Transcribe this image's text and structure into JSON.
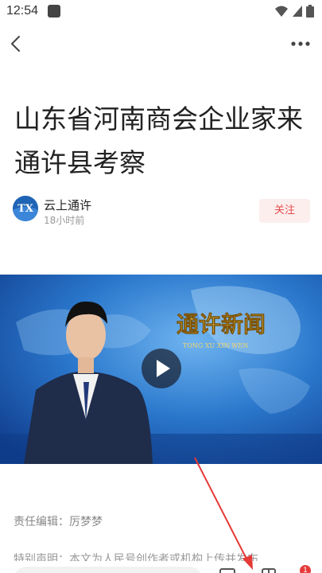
{
  "status_bar": {
    "time": "12:54"
  },
  "article": {
    "title": "山东省河南商会企业家来通许县考察",
    "author": {
      "name": "云上通许",
      "time": "18小时前",
      "avatar_text": "TX"
    },
    "follow_label": "关注",
    "video": {
      "overlay_title": "通许新闻",
      "overlay_subtitle": "TONG  XU  XIN  WEN"
    },
    "editor_line": "责任编辑：厉梦梦",
    "special_statement": "特别声明：本文为人民号创作者或机构上传并发布"
  },
  "bottom_bar": {
    "badge_count": "1"
  },
  "colors": {
    "accent": "#e74c4c",
    "follow_bg": "#fdeeee",
    "video_bg": "#1b61b8"
  }
}
